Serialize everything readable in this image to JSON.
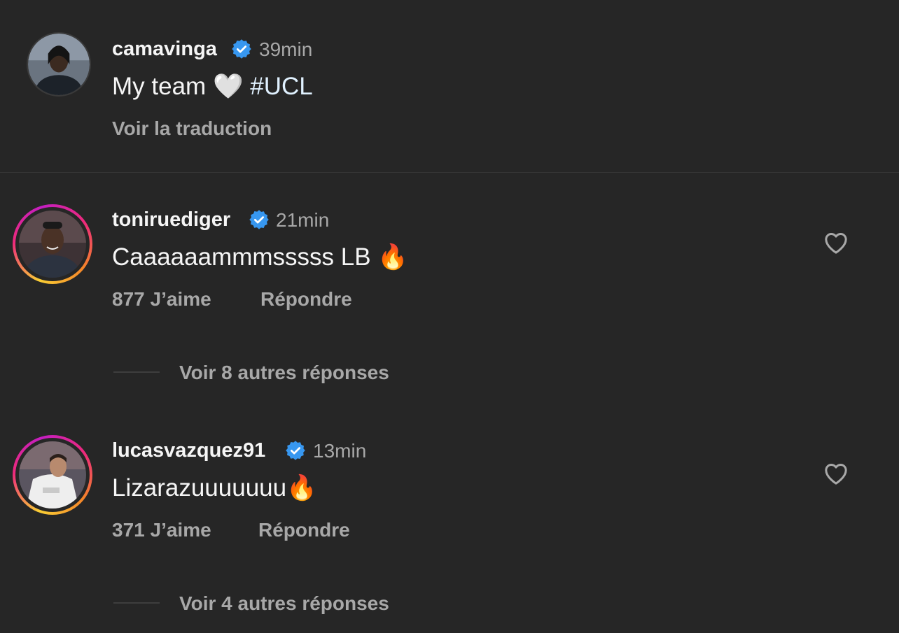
{
  "caption": {
    "username": "camavinga",
    "time": "39min",
    "text": "My team",
    "emoji": "🤍",
    "hashtag": "#UCL",
    "translate": "Voir la traduction"
  },
  "comments": [
    {
      "username": "toniruediger",
      "time": "21min",
      "text": "Caaaaaammmsssss LB",
      "emoji": "🔥",
      "likes": "877 J’aime",
      "reply": "Répondre",
      "more_replies": "Voir 8 autres réponses"
    },
    {
      "username": "lucasvazquez91",
      "time": "13min",
      "text": "Lizarazuuuuuuu",
      "emoji": "🔥",
      "likes": "371 J’aime",
      "reply": "Répondre",
      "more_replies": "Voir 4 autres réponses"
    }
  ],
  "colors": {
    "background": "#262626",
    "verified": "#3797f0",
    "muted": "#a8a8a8"
  },
  "icons": [
    "verified-badge-icon",
    "heart-outline-icon"
  ]
}
